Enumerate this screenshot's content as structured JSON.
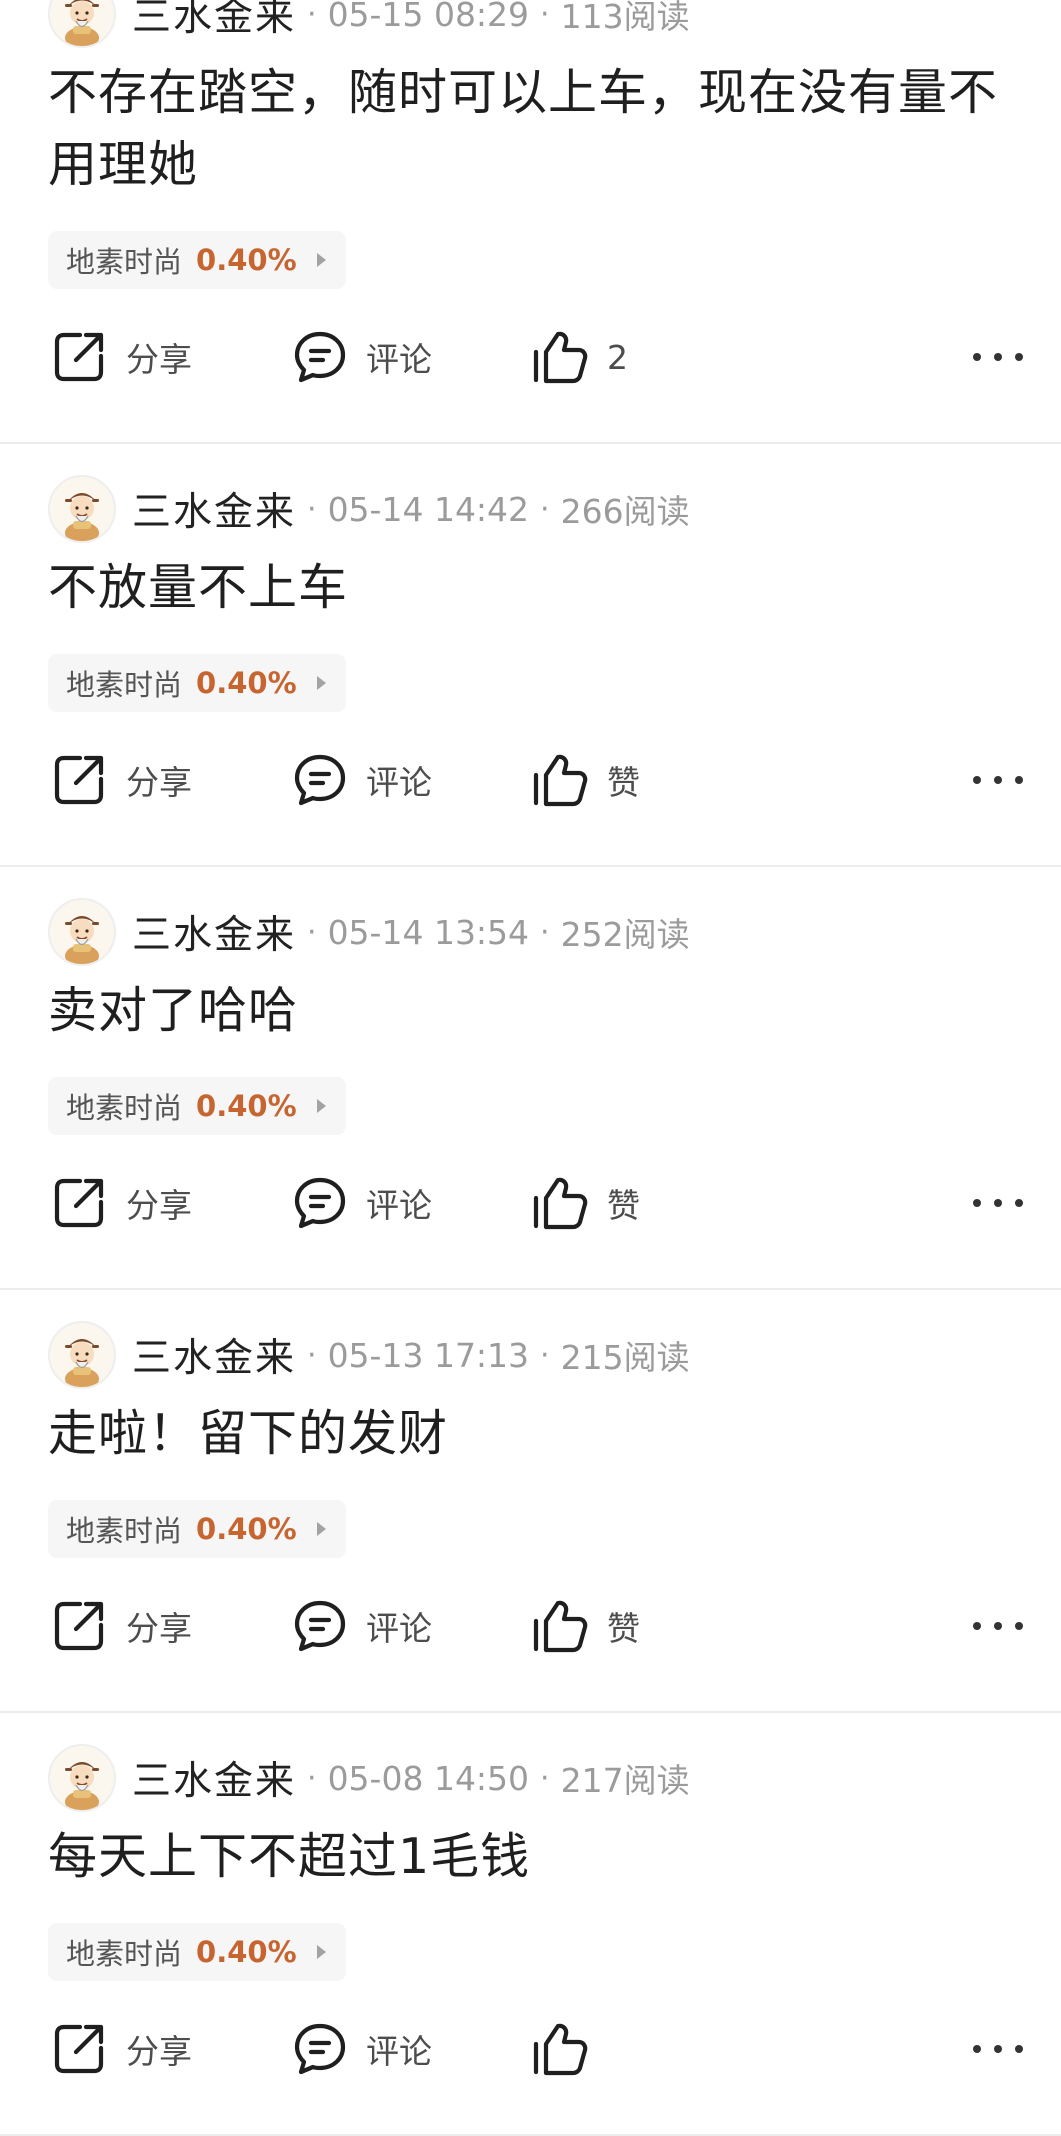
{
  "labels": {
    "share": "分享",
    "comment": "评论"
  },
  "posts": [
    {
      "author": "三水金来",
      "time": "05-15 08:29",
      "reads": "113阅读",
      "lines": [
        "不存在踏空，随时可以上车，现在没有量不",
        "用理她"
      ],
      "stock": "地素时尚",
      "change": "0.40%",
      "like": "2"
    },
    {
      "author": "三水金来",
      "time": "05-14 14:42",
      "reads": "266阅读",
      "lines": [
        "不放量不上车"
      ],
      "stock": "地素时尚",
      "change": "0.40%",
      "like": "赞"
    },
    {
      "author": "三水金来",
      "time": "05-14 13:54",
      "reads": "252阅读",
      "lines": [
        "卖对了哈哈"
      ],
      "stock": "地素时尚",
      "change": "0.40%",
      "like": "赞"
    },
    {
      "author": "三水金来",
      "time": "05-13 17:13",
      "reads": "215阅读",
      "lines": [
        "走啦！留下的发财"
      ],
      "stock": "地素时尚",
      "change": "0.40%",
      "like": "赞"
    },
    {
      "author": "三水金来",
      "time": "05-08 14:50",
      "reads": "217阅读",
      "lines": [
        "每天上下不超过1毛钱"
      ],
      "stock": "地素时尚",
      "change": "0.40%",
      "like": ""
    }
  ],
  "icons": {
    "share": "share-icon",
    "comment": "comment-icon",
    "like": "thumbs-up-icon",
    "more": "more-dots-icon"
  },
  "colors": {
    "background": "#ffffff",
    "text": "#1f1f1f",
    "meta": "#9b9b9b",
    "stock_change": "#c76531",
    "tag_background": "#f6f6f6",
    "divider": "#ececec"
  }
}
